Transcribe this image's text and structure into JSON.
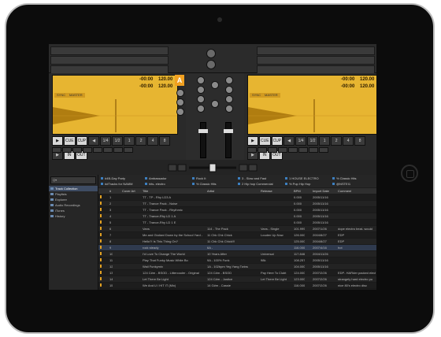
{
  "deckA": {
    "letter": "A",
    "time_remaining": "-00:00",
    "time_elapsed": "-00:00",
    "bpm": "120.00",
    "bpm2": "120.00",
    "sync_label": "SYNC",
    "master_label": "MASTER",
    "cue_label": "CUE",
    "cup_label": "CUP",
    "in_label": "IN",
    "out_label": "OUT",
    "loop_sizes": [
      "1/4",
      "1/2",
      "1",
      "2",
      "4",
      "8"
    ]
  },
  "deckB": {
    "time_remaining": "-00:00",
    "time_elapsed": "-00:00",
    "bpm": "120.00",
    "bpm2": "120.00",
    "sync_label": "SYNC",
    "master_label": "MASTER",
    "cue_label": "CUE",
    "cup_label": "CUP",
    "in_label": "IN",
    "out_label": "OUT",
    "loop_sizes": [
      "1/4",
      "1/2",
      "1",
      "2",
      "4",
      "8"
    ]
  },
  "browser": {
    "tree_items": [
      "Track Collection",
      "Playlists",
      "Explorer",
      "Audio Recordings",
      "iTunes",
      "History"
    ],
    "favorites": [
      [
        "#4B-Day Party",
        "Ambassador",
        "Rock It",
        "3 - Slow and Fast",
        "1 HOUSE ELECTRO",
        "% Classic Hits"
      ],
      [
        "##Tracks for NAMM",
        "hits- electro",
        "% Classic Hits",
        "2 Hip hop Commercial",
        "% Pop Hip Hop",
        "@NSTEI1"
      ]
    ],
    "columns": [
      "#",
      "Cover Art",
      "Title",
      "Artist",
      "Release",
      "BPM",
      "Import Date",
      "Comment"
    ],
    "rows": [
      {
        "num": "1",
        "title": "TT - TP - Rhy LD3 A",
        "artist": "",
        "release": "",
        "bpm": "0.000",
        "date": "2005/11/16",
        "comment": ""
      },
      {
        "num": "2",
        "title": "TT - Trance Pack - Noise",
        "artist": "",
        "release": "",
        "bpm": "0.000",
        "date": "2005/11/16",
        "comment": ""
      },
      {
        "num": "3",
        "title": "TT - Trance Pack - Rhythmic",
        "artist": "",
        "release": "",
        "bpm": "0.000",
        "date": "2005/11/16",
        "comment": ""
      },
      {
        "num": "4",
        "title": "TT - Trance-Rhy LD 1 A",
        "artist": "",
        "release": "",
        "bpm": "0.000",
        "date": "2005/11/16",
        "comment": ""
      },
      {
        "num": "5",
        "title": "TT - Trance-Rhy LD 1 E",
        "artist": "",
        "release": "",
        "bpm": "0.000",
        "date": "2005/11/16",
        "comment": ""
      },
      {
        "num": "6",
        "title": "Vans",
        "artist": "114 - The Pack",
        "release": "Vans - Single",
        "bpm": "101.999",
        "date": "2007/1/26",
        "comment": "dope electro beat- would"
      },
      {
        "num": "7",
        "title": "Me and Giuliani Down by the School Yard -",
        "artist": "11 Chk Chk Chick",
        "release": "Louden Up Now",
        "bpm": "126.000",
        "date": "2004/8/27",
        "comment": "EDP"
      },
      {
        "num": "8",
        "title": "Hello?! Is This Thing On?",
        "artist": "11 Chk Chk Chick!!!",
        "release": "",
        "bpm": "125.000",
        "date": "2004/8/27",
        "comment": "EDP"
      },
      {
        "num": "9",
        "title": "rock steady",
        "artist": "6A -",
        "release": "",
        "bpm": "116.000",
        "date": "2007/4/16",
        "comment": "hot"
      },
      {
        "num": "10",
        "title": "I'd Love To Change The World",
        "artist": "10 Years After",
        "release": "Universal",
        "bpm": "117.846",
        "date": "2004/11/26",
        "comment": ""
      },
      {
        "num": "11",
        "title": "Play That Funky Music White Bo",
        "artist": "9A - 100% Funk",
        "release": "98k",
        "bpm": "108.257",
        "date": "2005/11/16",
        "comment": ""
      },
      {
        "num": "12",
        "title": "Wail Funkymix",
        "artist": "1A - 102bpm Yeg Yang Twins",
        "release": "",
        "bpm": "104.000",
        "date": "2005/11/16",
        "comment": ""
      },
      {
        "num": "13",
        "title": "124 C#m - BSOD - Littercooler - Original",
        "artist": "124 C#m - BSOD",
        "release": "Pay Here To Clubt",
        "bpm": "124.000",
        "date": "2007/2/26",
        "comment": "EDP- HARder packed electr"
      },
      {
        "num": "14",
        "title": "Let There Be Light",
        "artist": "124 C#m - Justice",
        "release": "Let There Be Light",
        "bpm": "123.000",
        "date": "2007/2/26",
        "comment": "strangely hard electro pu"
      },
      {
        "num": "15",
        "title": "We And U / HIT IT (Mix)",
        "artist": "14 G#m - Cassie",
        "release": "",
        "bpm": "116.000",
        "date": "2007/2/26",
        "comment": "nice 80's electro disc"
      }
    ]
  },
  "colors": {
    "accent": "#e7b531",
    "deck_letter": "#f0a020",
    "selection": "#3e4c63"
  }
}
